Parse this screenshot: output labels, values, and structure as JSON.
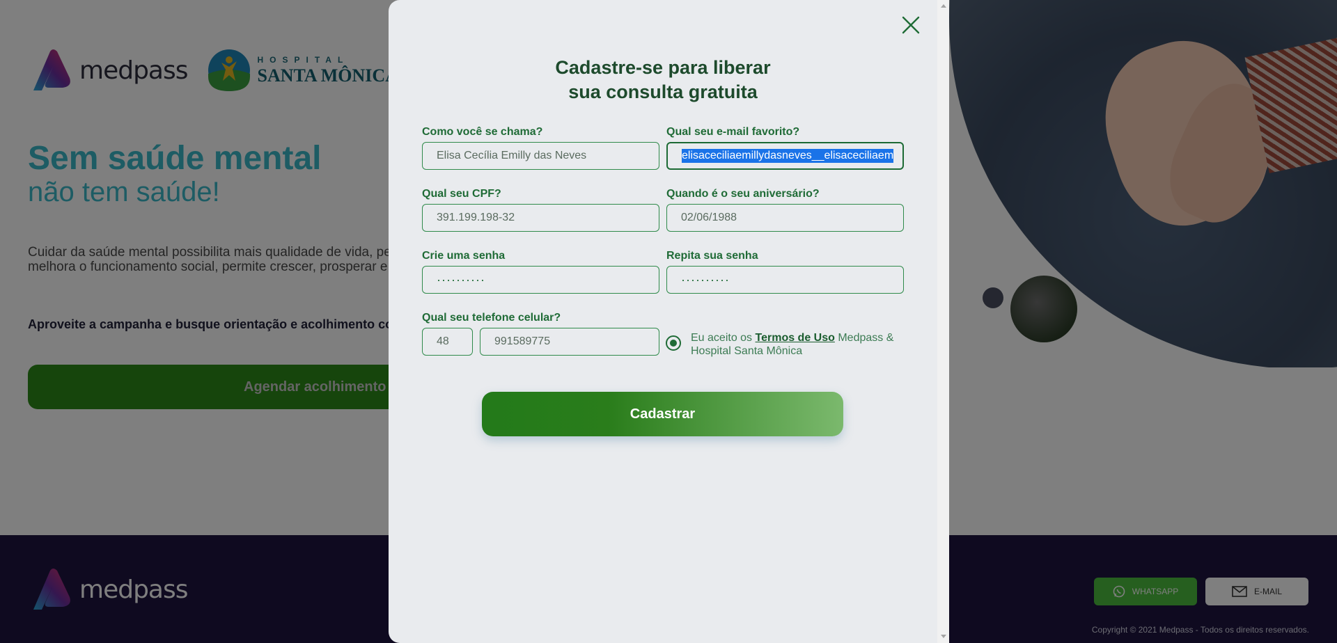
{
  "background": {
    "brand": "medpass",
    "partner_top": "HOSPITAL",
    "partner_bottom": "SANTA MÔNICA",
    "headline": "Sem saúde mental",
    "subheadline": "não tem saúde!",
    "body_line1": "Cuidar da saúde mental possibilita mais qualidade de vida, permite",
    "body_line2": "melhora o funcionamento social, permite crescer, prosperar e perfe",
    "campaign": "Aproveite a campanha e busque orientação e acolhimento com u",
    "cta_label": "Agendar acolhimento g",
    "footer_brand": "medpass",
    "whatsapp_label": "WHATSAPP",
    "email_label": "E-MAIL",
    "copyright": "Copyright © 2021 Medpass - Todos os direitos reservados."
  },
  "modal": {
    "title_line1": "Cadastre-se para liberar",
    "title_line2": "sua consulta gratuita",
    "fields": {
      "name": {
        "label": "Como você se chama?",
        "value": "Elisa Cecília Emilly das Neves"
      },
      "email": {
        "label": "Qual seu e-mail favorito?",
        "value": "elisaceciliaemillydasneves__elisaceciliaem"
      },
      "cpf": {
        "label": "Qual seu CPF?",
        "value": "391.199.198-32"
      },
      "birthday": {
        "label": "Quando é o seu aniversário?",
        "value": "02/06/1988"
      },
      "password": {
        "label": "Crie uma senha",
        "value": "··········"
      },
      "password_repeat": {
        "label": "Repita sua senha",
        "value": "··········"
      },
      "phone": {
        "label": "Qual seu telefone celular?",
        "ddd": "48",
        "number": "991589775"
      }
    },
    "terms": {
      "prefix": "Eu aceito os ",
      "link": "Termos de Uso",
      "suffix": " Medpass & Hospital Santa Mônica",
      "checked": true
    },
    "submit_label": "Cadastrar"
  },
  "colors": {
    "brand_green": "#2a7d1b",
    "label_green": "#1f6b36",
    "accent_teal": "#3ab8c8",
    "footer": "#1e1440",
    "whatsapp": "#4cbf3e",
    "selection": "#1a73e8"
  }
}
